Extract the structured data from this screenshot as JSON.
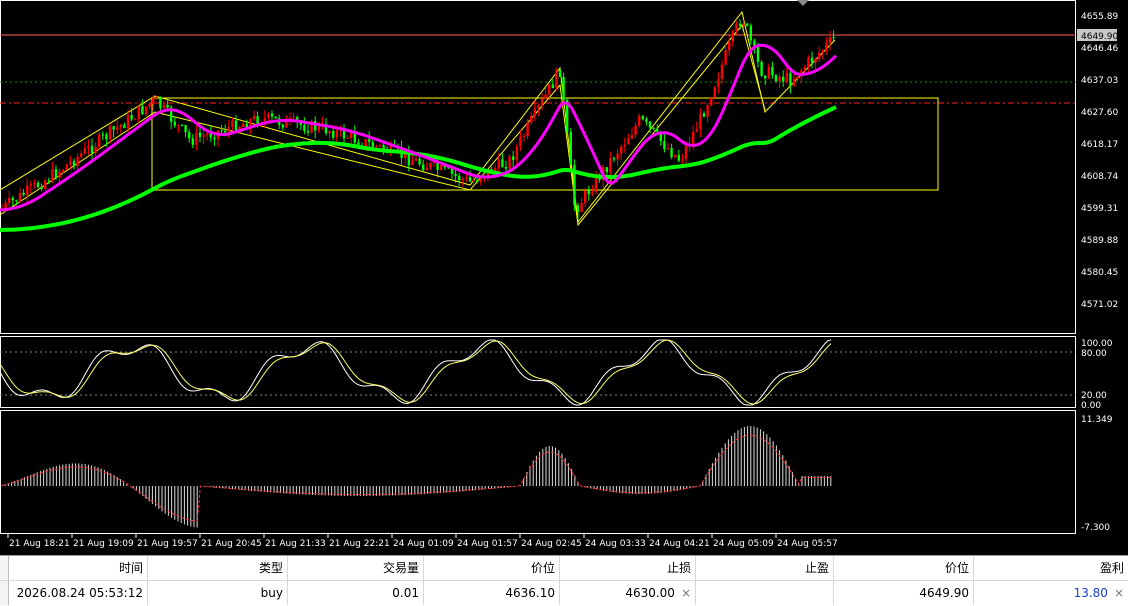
{
  "chart": {
    "price_ticks": [
      "4655.89",
      "4646.46",
      "4637.03",
      "4627.60",
      "4618.17",
      "4608.74",
      "4599.31",
      "4589.88",
      "4580.45",
      "4571.02"
    ],
    "current_price_label": "4649.90",
    "stoch_ticks": [
      "100.00",
      "80.00",
      "20.00",
      "0.00"
    ],
    "macd_ticks": [
      "11.349",
      "-7.300"
    ],
    "time_labels": [
      "21 Aug 18:21",
      "21 Aug 19:09",
      "21 Aug 19:57",
      "21 Aug 20:45",
      "21 Aug 21:33",
      "21 Aug 22:21",
      "24 Aug 01:09",
      "24 Aug 01:57",
      "24 Aug 02:45",
      "24 Aug 03:33",
      "24 Aug 04:21",
      "24 Aug 05:09",
      "24 Aug 05:57"
    ],
    "colors": {
      "bull": "#ff0000",
      "bear": "#00ff00",
      "ma_fast": "#ff00ff",
      "ma_slow": "#00ff00",
      "fractal_box": "#ffff00",
      "stoch": "#ffff66",
      "histogram": "#ffffff",
      "signal": "#ff0000"
    }
  },
  "trade_table": {
    "headers": {
      "time": "时间",
      "type": "类型",
      "volume": "交易量",
      "price": "价位",
      "sl": "止损",
      "tp": "止盈",
      "current_price": "价位",
      "profit": "盈利"
    },
    "row": {
      "time": "2026.08.24 05:53:12",
      "type": "buy",
      "volume": "0.01",
      "price": "4636.10",
      "sl": "4630.00",
      "tp": "",
      "current_price": "4649.90",
      "profit": "13.80",
      "close_icon": "×"
    }
  }
}
